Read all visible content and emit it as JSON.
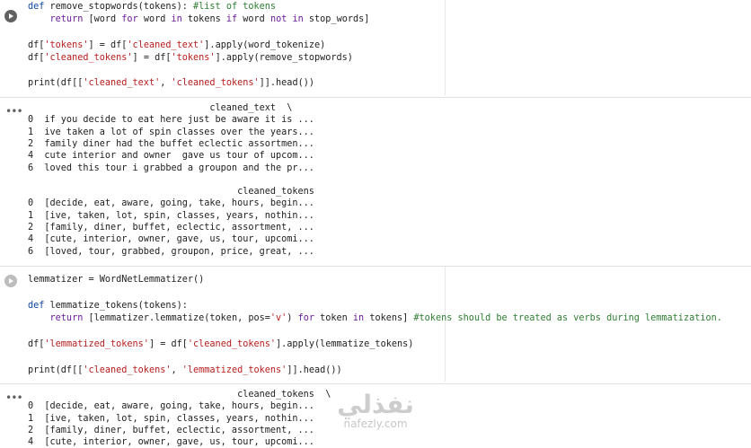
{
  "cell1": {
    "lines": [
      [
        {
          "t": "def",
          "c": "kw"
        },
        {
          "t": " remove_stopwords(tokens): ",
          "c": "fn"
        },
        {
          "t": "#list of tokens",
          "c": "cmt"
        }
      ],
      [
        {
          "t": "    return",
          "c": "kw2"
        },
        {
          "t": " [word ",
          "c": "fn"
        },
        {
          "t": "for",
          "c": "kw2"
        },
        {
          "t": " word ",
          "c": "fn"
        },
        {
          "t": "in",
          "c": "kw2"
        },
        {
          "t": " tokens ",
          "c": "fn"
        },
        {
          "t": "if",
          "c": "kw2"
        },
        {
          "t": " word ",
          "c": "fn"
        },
        {
          "t": "not in",
          "c": "kw2"
        },
        {
          "t": " stop_words]",
          "c": "fn"
        }
      ],
      [],
      [
        {
          "t": "df[",
          "c": "fn"
        },
        {
          "t": "'tokens'",
          "c": "str"
        },
        {
          "t": "] = df[",
          "c": "fn"
        },
        {
          "t": "'cleaned_text'",
          "c": "str"
        },
        {
          "t": "].apply(word_tokenize)",
          "c": "fn"
        }
      ],
      [
        {
          "t": "df[",
          "c": "fn"
        },
        {
          "t": "'cleaned_tokens'",
          "c": "str"
        },
        {
          "t": "] = df[",
          "c": "fn"
        },
        {
          "t": "'tokens'",
          "c": "str"
        },
        {
          "t": "].apply(remove_stopwords)",
          "c": "fn"
        }
      ],
      [],
      [
        {
          "t": "print(df[[",
          "c": "fn"
        },
        {
          "t": "'cleaned_text'",
          "c": "str"
        },
        {
          "t": ", ",
          "c": "fn"
        },
        {
          "t": "'cleaned_tokens'",
          "c": "str"
        },
        {
          "t": "]].head())",
          "c": "fn"
        }
      ]
    ]
  },
  "output1": {
    "lines": [
      "                                 cleaned_text  \\",
      "0  if you decide to eat here just be aware it is ...",
      "1  ive taken a lot of spin classes over the years...",
      "2  family diner had the buffet eclectic assortmen...",
      "4  cute interior and owner  gave us tour of upcom...",
      "6  loved this tour i grabbed a groupon and the pr...",
      "",
      "                                      cleaned_tokens",
      "0  [decide, eat, aware, going, take, hours, begin...",
      "1  [ive, taken, lot, spin, classes, years, nothin...",
      "2  [family, diner, buffet, eclectic, assortment, ...",
      "4  [cute, interior, owner, gave, us, tour, upcomi...",
      "6  [loved, tour, grabbed, groupon, price, great, ..."
    ]
  },
  "cell2": {
    "lines": [
      [
        {
          "t": "lemmatizer = WordNetLemmatizer()",
          "c": "fn"
        }
      ],
      [],
      [
        {
          "t": "def",
          "c": "kw"
        },
        {
          "t": " lemmatize_tokens(tokens):",
          "c": "fn"
        }
      ],
      [
        {
          "t": "    return",
          "c": "kw2"
        },
        {
          "t": " [lemmatizer.lemmatize(token, pos=",
          "c": "fn"
        },
        {
          "t": "'v'",
          "c": "str"
        },
        {
          "t": ") ",
          "c": "fn"
        },
        {
          "t": "for",
          "c": "kw2"
        },
        {
          "t": " token ",
          "c": "fn"
        },
        {
          "t": "in",
          "c": "kw2"
        },
        {
          "t": " tokens] ",
          "c": "fn"
        },
        {
          "t": "#tokens should be treated as verbs during lemmatization.",
          "c": "cmt"
        }
      ],
      [],
      [
        {
          "t": "df[",
          "c": "fn"
        },
        {
          "t": "'lemmatized_tokens'",
          "c": "str"
        },
        {
          "t": "] = df[",
          "c": "fn"
        },
        {
          "t": "'cleaned_tokens'",
          "c": "str"
        },
        {
          "t": "].apply(lemmatize_tokens)",
          "c": "fn"
        }
      ],
      [],
      [
        {
          "t": "print(df[[",
          "c": "fn"
        },
        {
          "t": "'cleaned_tokens'",
          "c": "str"
        },
        {
          "t": ", ",
          "c": "fn"
        },
        {
          "t": "'lemmatized_tokens'",
          "c": "str"
        },
        {
          "t": "]].head())",
          "c": "fn"
        }
      ]
    ]
  },
  "output2": {
    "lines": [
      "                                      cleaned_tokens  \\",
      "0  [decide, eat, aware, going, take, hours, begin...",
      "1  [ive, taken, lot, spin, classes, years, nothin...",
      "2  [family, diner, buffet, eclectic, assortment, ...",
      "4  [cute, interior, owner, gave, us, tour, upcomi..."
    ]
  },
  "watermark": {
    "arabic": "نفذلي",
    "latin": "nafezly.com"
  },
  "icons": {
    "run": "play-icon",
    "output": "more-horiz-icon"
  }
}
